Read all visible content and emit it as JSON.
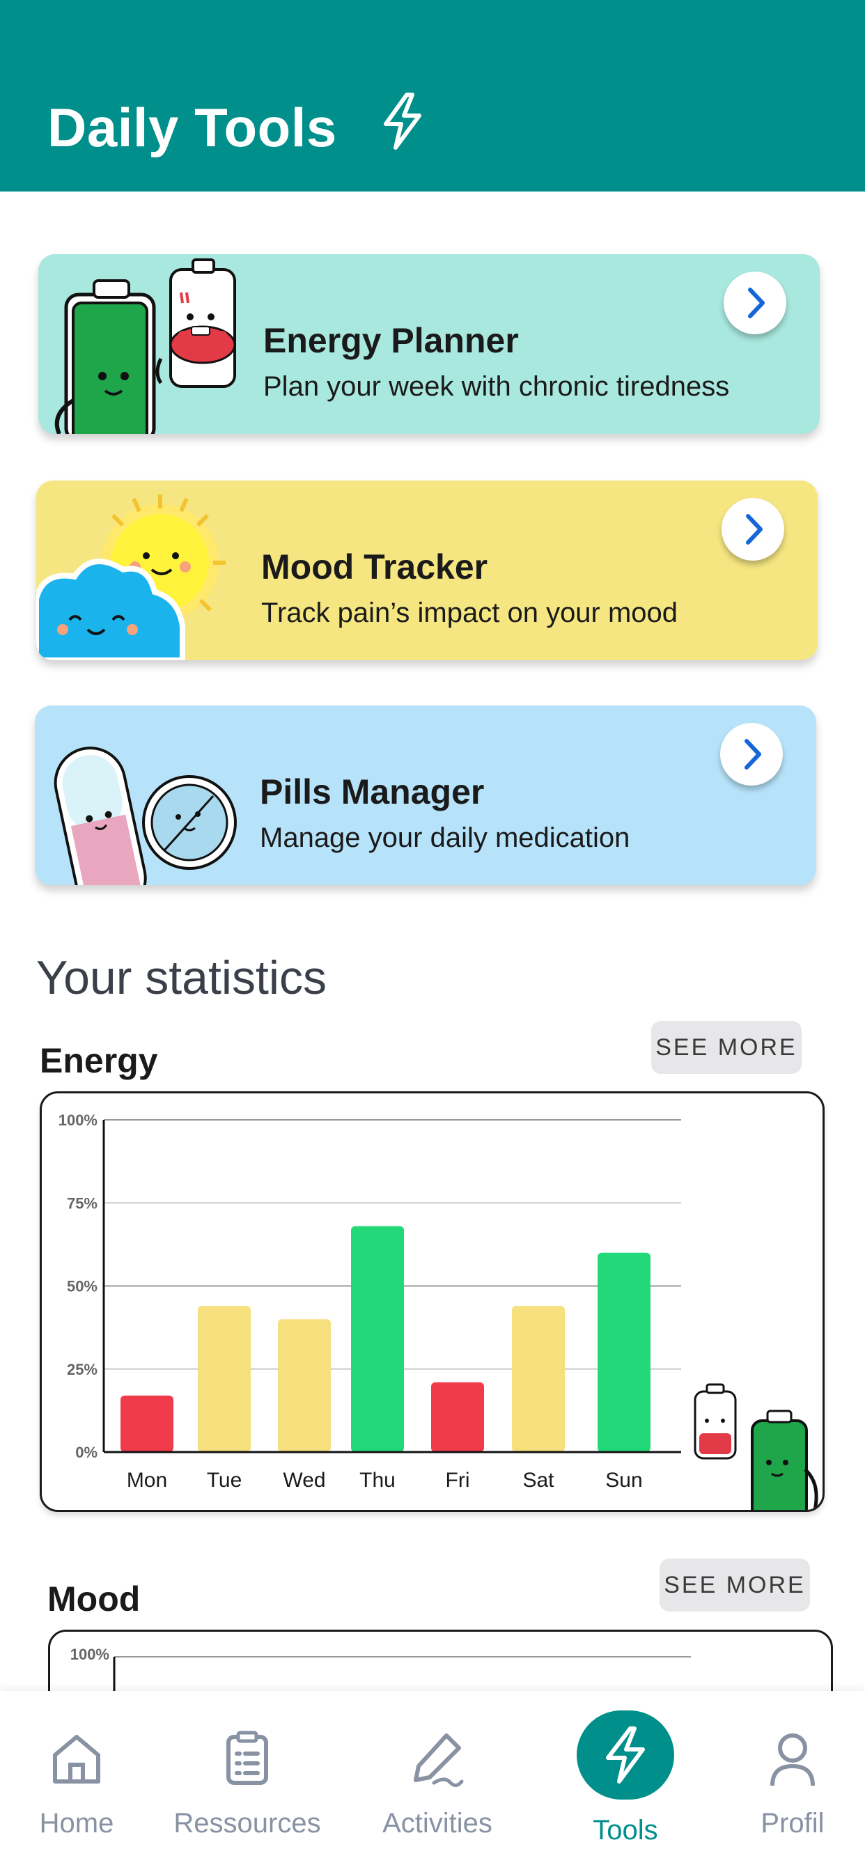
{
  "header": {
    "title": "Daily Tools",
    "icon": "bolt-icon"
  },
  "tools": [
    {
      "title": "Energy Planner",
      "subtitle": "Plan your week with chronic tiredness",
      "color": "#a9e8df",
      "icon": "battery-characters-icon"
    },
    {
      "title": "Mood Tracker",
      "subtitle": "Track pain’s impact on your mood",
      "color": "#f5e682",
      "icon": "sun-cloud-icon"
    },
    {
      "title": "Pills Manager",
      "subtitle": "Manage your daily medication",
      "color": "#b7e3fa",
      "icon": "pill-characters-icon"
    }
  ],
  "statistics": {
    "heading": "Your statistics",
    "energy": {
      "title": "Energy",
      "see_more": "SEE MORE"
    },
    "mood": {
      "title": "Mood",
      "see_more": "SEE MORE",
      "top_tick": "100%"
    }
  },
  "chart_data": {
    "type": "bar",
    "categories": [
      "Mon",
      "Tue",
      "Wed",
      "Thu",
      "Fri",
      "Sat",
      "Sun"
    ],
    "values": [
      17,
      44,
      40,
      68,
      21,
      44,
      60
    ],
    "colors": [
      "#ef3b4a",
      "#f5e07d",
      "#f5e07d",
      "#23d878",
      "#ef3b4a",
      "#f5e07d",
      "#23d878"
    ],
    "yticks": [
      "0%",
      "25%",
      "50%",
      "75%",
      "100%"
    ],
    "ylim": [
      0,
      100
    ]
  },
  "nav": {
    "items": [
      {
        "label": "Home",
        "icon": "home-icon",
        "active": false
      },
      {
        "label": "Ressources",
        "icon": "clipboard-icon",
        "active": false
      },
      {
        "label": "Activities",
        "icon": "pen-icon",
        "active": false
      },
      {
        "label": "Tools",
        "icon": "bolt-icon",
        "active": true
      },
      {
        "label": "Profil",
        "icon": "user-icon",
        "active": false
      }
    ],
    "active_color": "#008f8a",
    "inactive_color": "#8892a3"
  }
}
